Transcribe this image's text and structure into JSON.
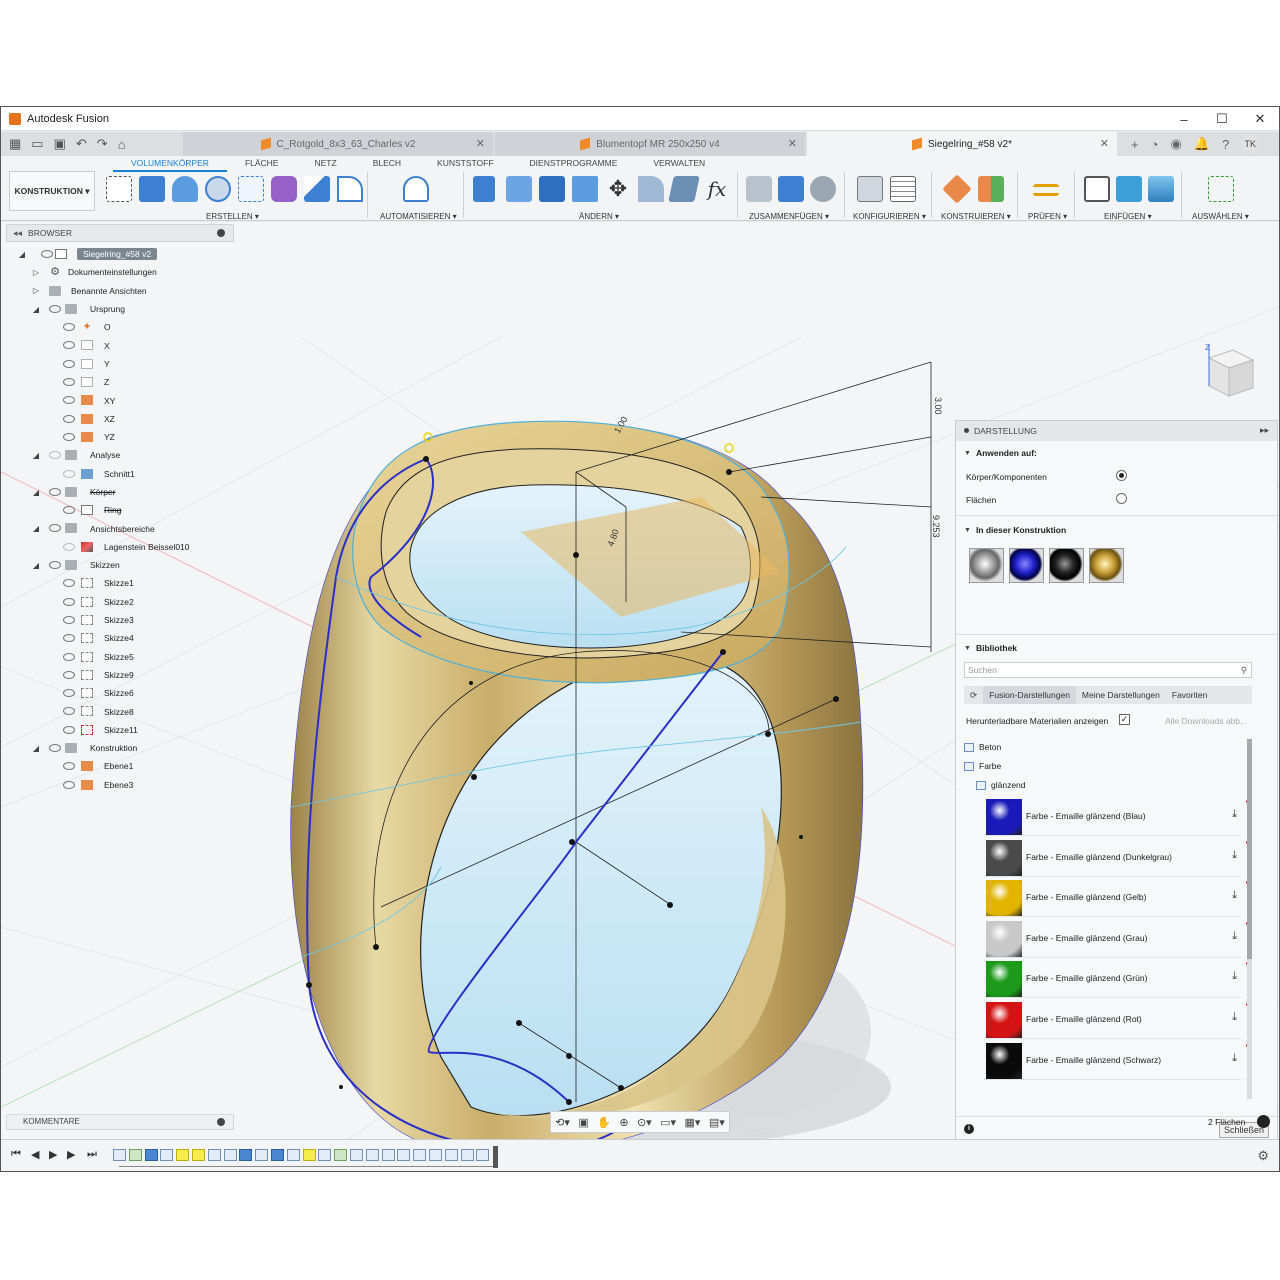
{
  "window": {
    "title": "Autodesk Fusion",
    "controls": [
      "–",
      "☐",
      "✕"
    ]
  },
  "tabs": [
    {
      "label": "C_Rotgold_8x3_63_Charles v2",
      "active": false
    },
    {
      "label": "Blumentopf MR 250x250 v4",
      "active": false
    },
    {
      "label": "Siegelring_#58 v2*",
      "active": true
    }
  ],
  "user_initials": "TK",
  "ribbon": {
    "workspace": "KONSTRUKTION",
    "tabs": [
      "VOLUMENKÖRPER",
      "FLÄCHE",
      "NETZ",
      "BLECH",
      "KUNSTSTOFF",
      "DIENSTPROGRAMME",
      "VERWALTEN"
    ],
    "groups": [
      "ERSTELLEN",
      "AUTOMATISIEREN",
      "ÄNDERN",
      "ZUSAMMENFÜGEN",
      "KONFIGURIEREN",
      "KONSTRUIEREN",
      "PRÜFEN",
      "EINFÜGEN",
      "AUSWÄHLEN"
    ]
  },
  "browser": {
    "title": "BROWSER",
    "root": "Siegelring_#58 v2",
    "items": [
      "Dokumenteinstellungen",
      "Benannte Ansichten",
      "Ursprung",
      "O",
      "X",
      "Y",
      "Z",
      "XY",
      "XZ",
      "YZ",
      "Analyse",
      "Schnitt1",
      "Körper",
      "Ring",
      "Ansichtsbereiche",
      "Lagenstein Beissel010",
      "Skizzen",
      "Skizze1",
      "Skizze2",
      "Skizze3",
      "Skizze4",
      "Skizze5",
      "Skizze9",
      "Skizze6",
      "Skizze8",
      "Skizze11",
      "Konstruktion",
      "Ebene1",
      "Ebene3"
    ]
  },
  "dimensions": {
    "d1": "3.00",
    "d2": "9.253",
    "d3": "1.00",
    "d4": "4.80"
  },
  "darstellung": {
    "title": "DARSTELLUNG",
    "apply_heading": "Anwenden auf:",
    "opt_bodies": "Körper/Komponenten",
    "opt_faces": "Flächen",
    "in_design_heading": "In dieser Konstruktion",
    "library_heading": "Bibliothek",
    "search_placeholder": "Suchen",
    "lib_tabs": [
      "Fusion-Darstellungen",
      "Meine Darstellungen",
      "Favoriten"
    ],
    "downloadable_label": "Herunterladbare Materialien anzeigen",
    "all_downloads": "Alle Downloads abb...",
    "folders": [
      "Beton",
      "Farbe",
      "glänzend"
    ],
    "materials": [
      {
        "name": "Farbe - Emaille glänzend (Blau)",
        "color": "#1a1ab8"
      },
      {
        "name": "Farbe - Emaille glänzend (Dunkelgrau)",
        "color": "#4a4a4a"
      },
      {
        "name": "Farbe - Emaille glänzend (Gelb)",
        "color": "#e0b400"
      },
      {
        "name": "Farbe - Emaille glänzend (Grau)",
        "color": "#c8c8c8"
      },
      {
        "name": "Farbe - Emaille glänzend (Grün)",
        "color": "#1b9a1b"
      },
      {
        "name": "Farbe - Emaille glänzend (Rot)",
        "color": "#d41414"
      },
      {
        "name": "Farbe - Emaille glänzend (Schwarz)",
        "color": "#0a0a0a"
      }
    ],
    "close_label": "Schließen"
  },
  "comments_label": "KOMMENTARE",
  "status_text": "2 Flächen"
}
